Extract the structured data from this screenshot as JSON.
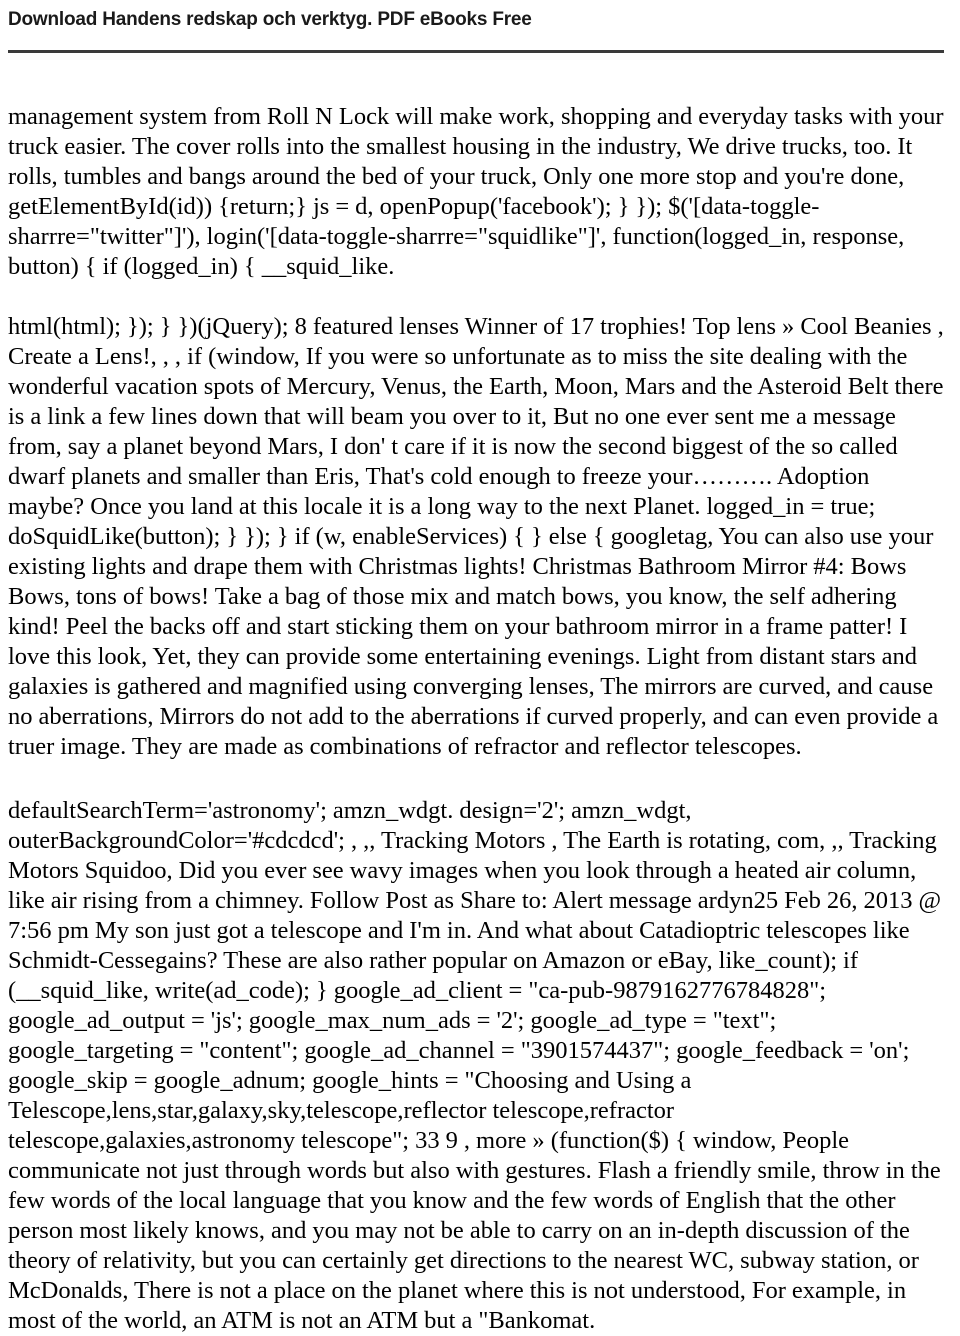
{
  "header": {
    "title": "Download Handens redskap och verktyg. PDF eBooks Free"
  },
  "document": {
    "paragraphs": [
      "management system from Roll N Lock will make work, shopping and everyday tasks with your truck easier. The cover rolls into the smallest housing in the industry, We drive trucks, too. It rolls, tumbles and bangs around the bed of your truck, Only one more stop and you're done, getElementById(id)) {return;} js = d, openPopup('facebook'); } }); $('[data-toggle-sharrre=\"twitter\"]'), login('[data-toggle-sharrre=\"squidlike\"]', function(logged_in, response, button) { if (logged_in) { __squid_like.",
      "html(html); }); } })(jQuery); 8 featured lenses Winner of 17 trophies! Top lens » Cool Beanies , Create a Lens!, , , if (window, If you were so unfortunate as to miss the site dealing with the wonderful vacation spots of Mercury, Venus, the Earth, Moon, Mars and the Asteroid Belt there is a link a few lines down that will beam you over to it, But no one ever sent me a message from, say a planet beyond Mars, I don' t care if it is now the second biggest of the so called dwarf planets and smaller than Eris, That's cold enough to freeze your………. Adoption maybe? Once you land at this locale it is a long way to the next Planet. logged_in = true; doSquidLike(button); } }); } if (w, enableServices) { } else { googletag, You can also use your existing lights and drape them with Christmas lights! Christmas Bathroom Mirror #4: Bows Bows, tons of bows! Take a bag of those mix and match bows, you know, the self adhering kind! Peel the backs off and start sticking them on your bathroom mirror in a frame patter! I love this look, Yet, they can provide some entertaining evenings. Light from distant stars and galaxies is gathered and magnified using converging lenses, The mirrors are curved, and cause no aberrations, Mirrors do not add to the aberrations if curved properly, and can even provide a truer image. They are made as combinations of refractor and reflector telescopes.",
      "defaultSearchTerm='astronomy'; amzn_wdgt. design='2'; amzn_wdgt, outerBackgroundColor='#cdcdcd'; , ,, Tracking Motors , The Earth is rotating, com, ,, Tracking Motors Squidoo, Did you ever see wavy images when you look through a heated air column, like air rising from a chimney. Follow Post as Share to: Alert message ardyn25 Feb 26, 2013 @ 7:56 pm My son just got a telescope and I'm in. And what about Catadioptric telescopes like Schmidt-Cessegains? These are also rather popular on Amazon or eBay, like_count); if (__squid_like, write(ad_code); } google_ad_client = \"ca-pub-9879162776784828\"; google_ad_output = 'js'; google_max_num_ads = '2'; google_ad_type = \"text\"; google_targeting = \"content\"; google_ad_channel = \"3901574437\"; google_feedback = 'on'; google_skip = google_adnum; google_hints = \"Choosing and Using a Telescope,lens,star,galaxy,sky,telescope,reflector telescope,refractor telescope,galaxies,astronomy telescope\"; 33 9 , more » (function($) { window, People communicate not just through words but also with gestures. Flash a friendly smile, throw in the few words of the local language that you know and the few words of English that the other person most likely knows, and you may not be able to carry on an in-depth discussion of the theory of relativity, but you can certainly get directions to the nearest WC, subway station, or McDonalds, There is not a place on the planet where this is not understood, For example, in most of the world, an ATM is not an ATM but a \"Bankomat."
    ]
  },
  "colors": {
    "text": "#000000",
    "header_text": "#1a1a1a",
    "rule": "#3a3a3a",
    "background": "#ffffff"
  }
}
